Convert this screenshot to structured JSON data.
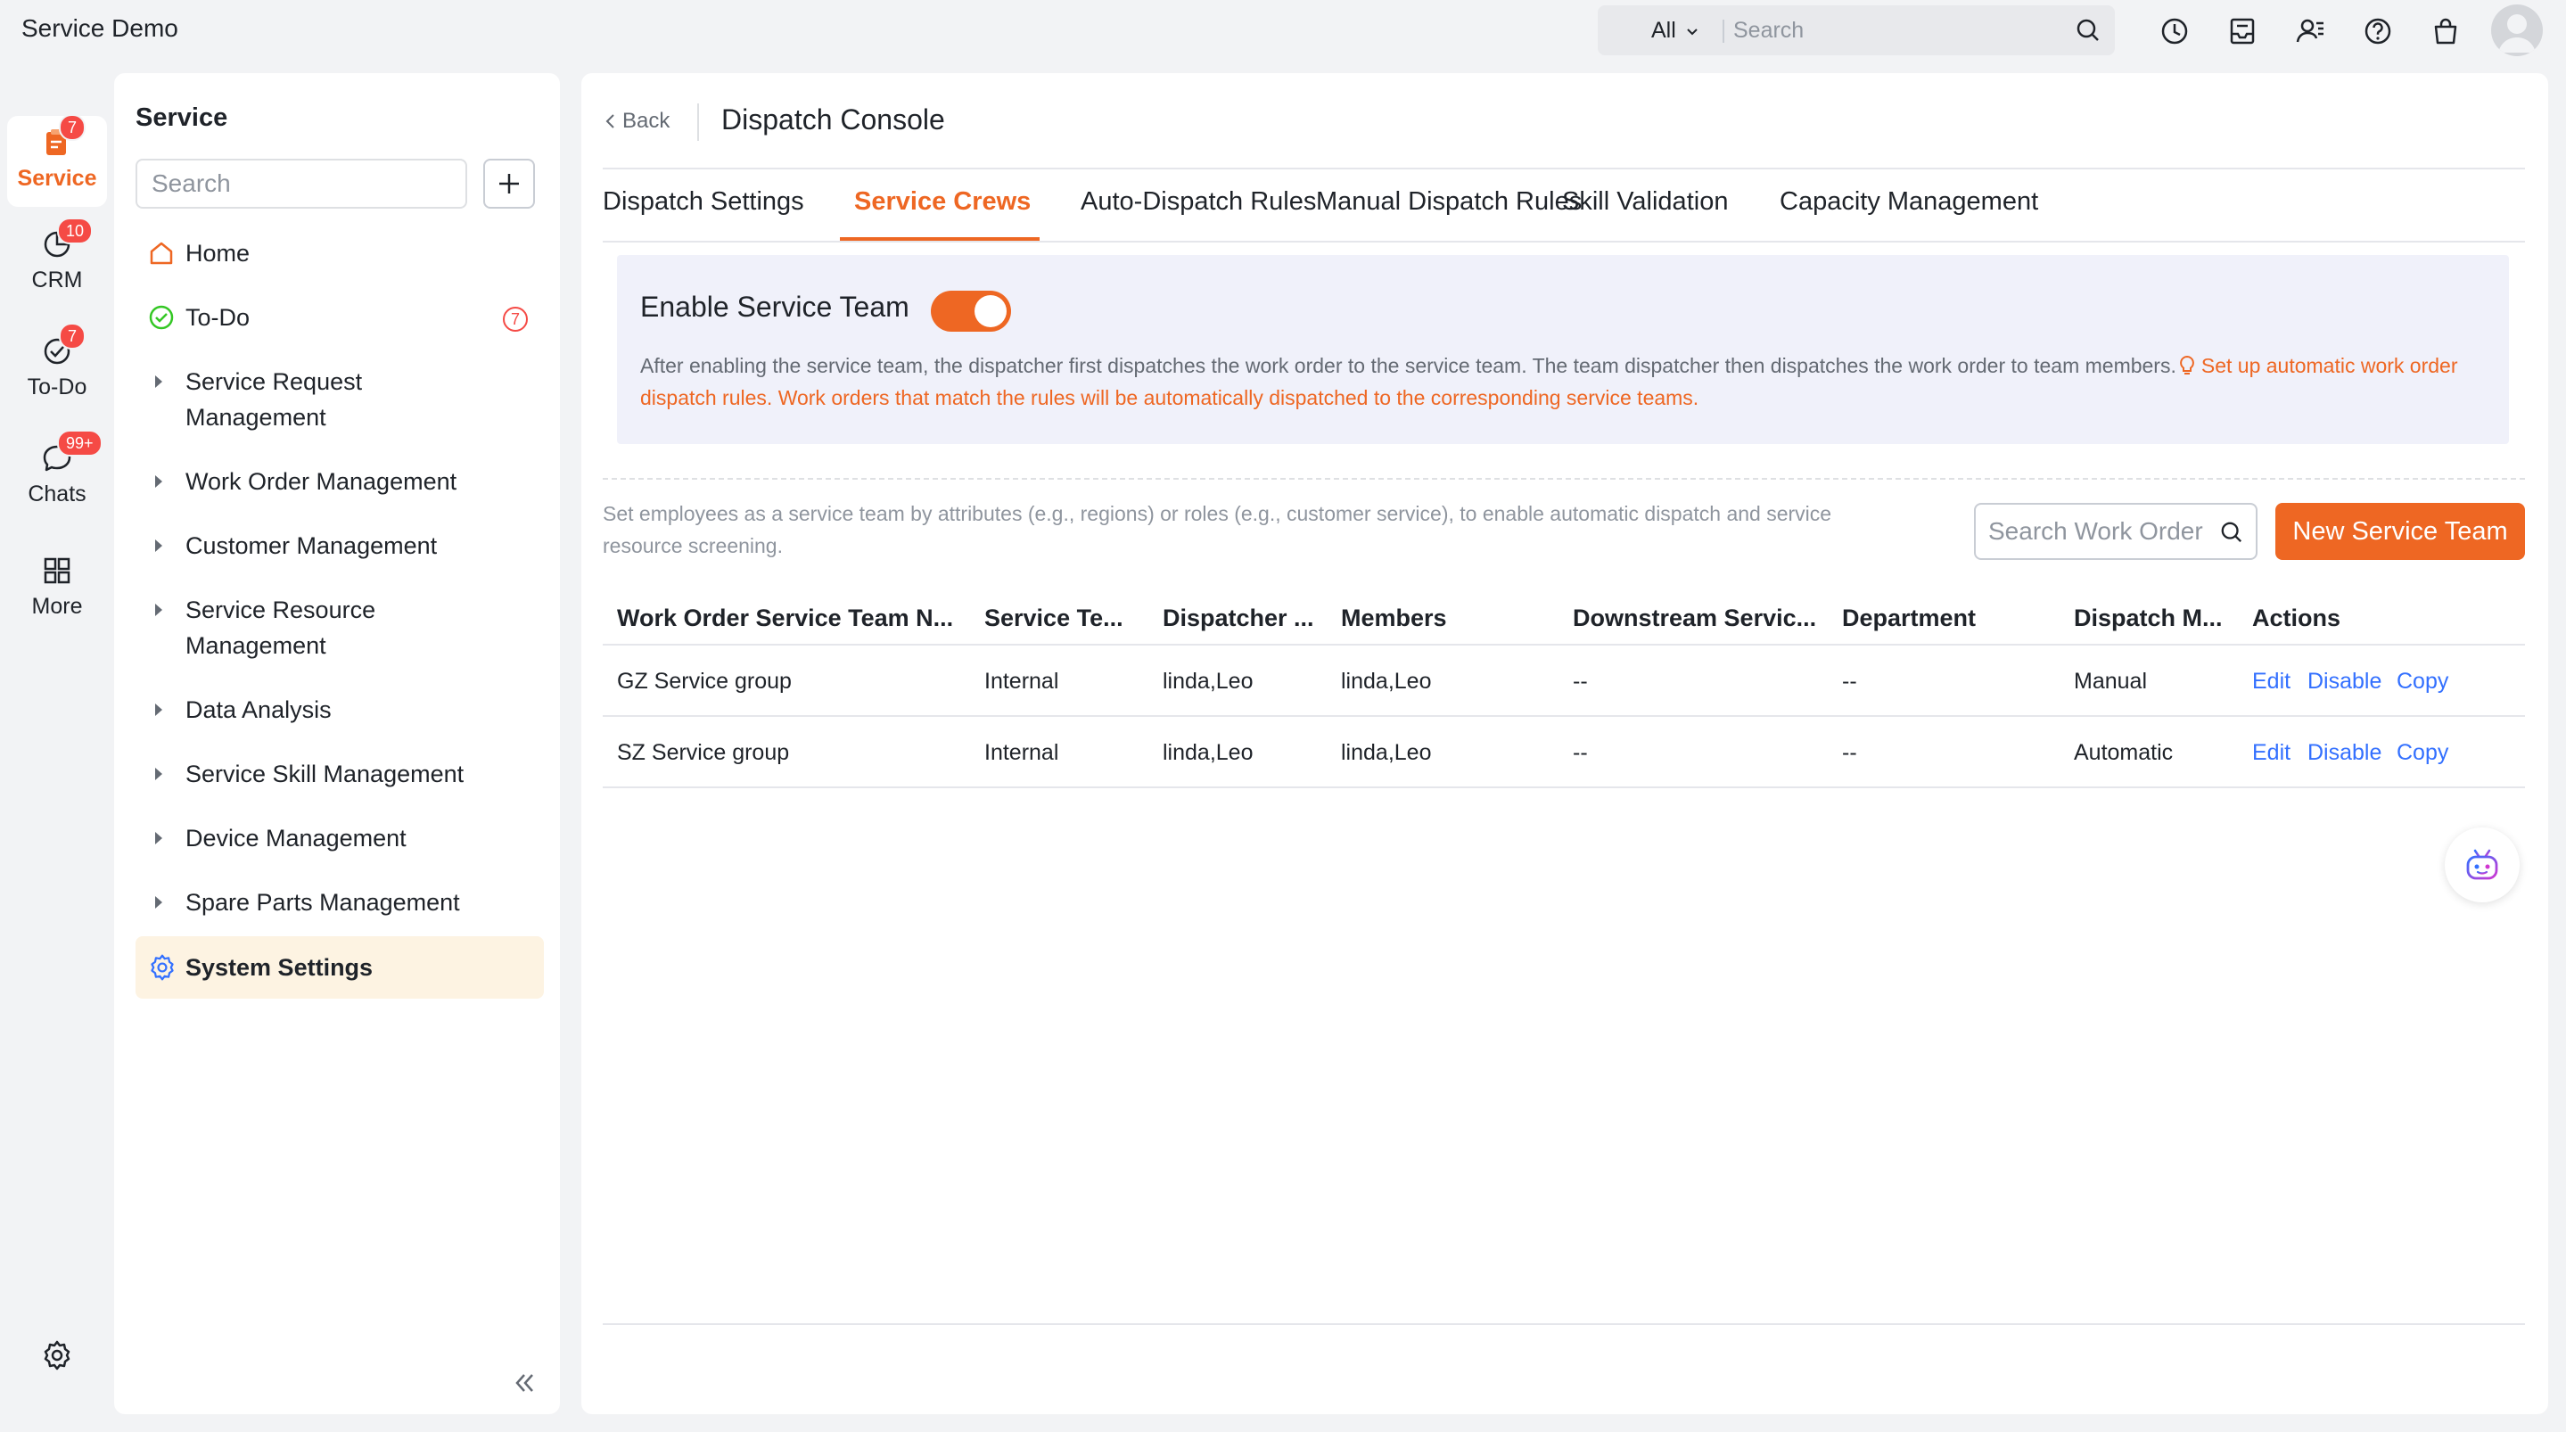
{
  "app": {
    "title": "Service Demo"
  },
  "topbar": {
    "scope": "All",
    "search_placeholder": "Search",
    "icons": [
      "history-icon",
      "inbox-icon",
      "contacts-icon",
      "help-icon",
      "store-icon",
      "avatar"
    ]
  },
  "rail": {
    "items": [
      {
        "label": "Service",
        "icon": "service-icon",
        "badge": "7",
        "active": true
      },
      {
        "label": "CRM",
        "icon": "crm-icon",
        "badge": "10"
      },
      {
        "label": "To-Do",
        "icon": "todo-icon",
        "badge": "7"
      },
      {
        "label": "Chats",
        "icon": "chat-icon",
        "badge": "99+"
      },
      {
        "label": "More",
        "icon": "grid-icon"
      }
    ]
  },
  "sidebar": {
    "title": "Service",
    "search_placeholder": "Search",
    "items": [
      {
        "label": "Home",
        "icon": "home-icon"
      },
      {
        "label": "To-Do",
        "icon": "check-circle-icon",
        "badge": "7"
      },
      {
        "label": "Service Request Management"
      },
      {
        "label": "Work Order Management"
      },
      {
        "label": "Customer Management"
      },
      {
        "label": "Service Resource Management"
      },
      {
        "label": "Data Analysis"
      },
      {
        "label": "Service Skill Management"
      },
      {
        "label": "Device Management"
      },
      {
        "label": "Spare Parts Management"
      },
      {
        "label": "System Settings",
        "icon": "gear-icon",
        "selected": true
      }
    ]
  },
  "main": {
    "back_label": "Back",
    "page_title": "Dispatch Console",
    "tabs": [
      {
        "label": "Dispatch Settings"
      },
      {
        "label": "Service Crews",
        "active": true
      },
      {
        "label": "Auto-Dispatch Rules"
      },
      {
        "label": "Manual Dispatch Rules"
      },
      {
        "label": "Skill Validation"
      },
      {
        "label": "Capacity Management"
      }
    ],
    "enable": {
      "title": "Enable Service Team",
      "enabled": true,
      "description": "After enabling the service team, the dispatcher first dispatches the work order to the service team. The team dispatcher then dispatches the work order to team members.",
      "link": "Set up automatic work order dispatch rules. Work orders that match the rules will be automatically dispatched to the corresponding service teams."
    },
    "hint": "Set employees as a service team by attributes (e.g., regions) or roles (e.g., customer service), to enable automatic dispatch and service resource screening.",
    "search_placeholder": "Search Work Order",
    "new_button": "New Service Team",
    "table": {
      "columns": [
        "Work Order Service Team N...",
        "Service Te...",
        "Dispatcher ...",
        "Members",
        "Downstream Servic...",
        "Department",
        "Dispatch M...",
        "Actions"
      ],
      "rows": [
        [
          "GZ Service group",
          "Internal",
          "linda,Leo",
          "linda,Leo",
          "--",
          "--",
          "Manual"
        ],
        [
          "SZ Service group",
          "Internal",
          "linda,Leo",
          "linda,Leo",
          "--",
          "--",
          "Automatic"
        ]
      ],
      "actions": [
        "Edit",
        "Disable",
        "Copy"
      ]
    }
  },
  "colors": {
    "accent": "#ee6723",
    "link": "#3370ff",
    "badge": "#f54a45",
    "selected_bg": "#fdf3e2"
  }
}
